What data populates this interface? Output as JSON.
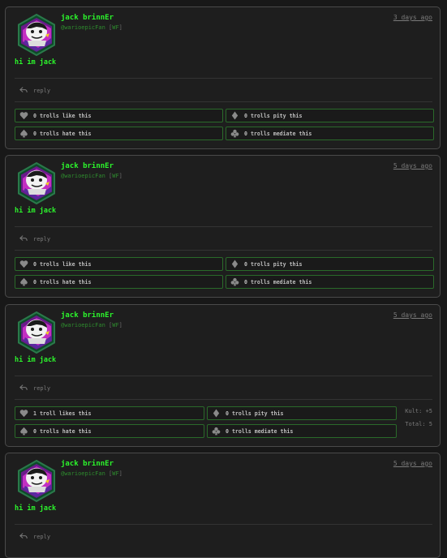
{
  "icons": {
    "reply": "reply-arrow-icon",
    "like": "heart-icon",
    "pity": "diamond-icon",
    "hate": "spade-icon",
    "mediate": "club-icon"
  },
  "posts": [
    {
      "username": "jack brinnEr",
      "handle": "@warioepicFan",
      "tag": "WF",
      "time": "3 days ago",
      "text": "hi im jack",
      "reply": "reply",
      "reactions": {
        "like": "0 trolls like this",
        "pity": "0 trolls pity this",
        "hate": "0 trolls hate this",
        "mediate": "0 trolls mediate this"
      }
    },
    {
      "username": "jack brinnEr",
      "handle": "@warioepicFan",
      "tag": "WF",
      "time": "5 days ago",
      "text": "hi im jack",
      "reply": "reply",
      "reactions": {
        "like": "0 trolls like this",
        "pity": "0 trolls pity this",
        "hate": "0 trolls hate this",
        "mediate": "0 trolls mediate this"
      }
    },
    {
      "username": "jack brinnEr",
      "handle": "@warioepicFan",
      "tag": "WF",
      "time": "5 days ago",
      "text": "hi im jack",
      "reply": "reply",
      "reactions": {
        "like": "1 troll likes this",
        "pity": "0 trolls pity this",
        "hate": "0 trolls hate this",
        "mediate": "0 trolls mediate this"
      },
      "kult": "Kult: +5",
      "total": "Total: 5"
    },
    {
      "username": "jack brinnEr",
      "handle": "@warioepicFan",
      "tag": "WF",
      "time": "5 days ago",
      "text": "hi im jack",
      "reply": "reply"
    }
  ]
}
